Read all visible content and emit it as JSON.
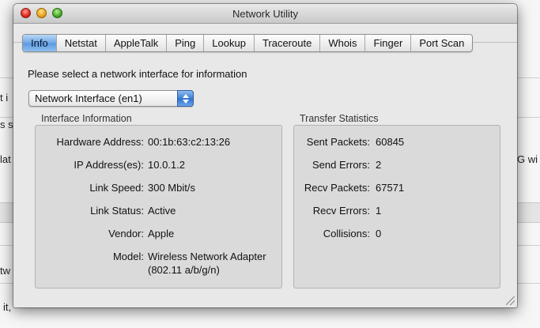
{
  "window": {
    "title": "Network Utility"
  },
  "tabs": [
    {
      "label": "Info",
      "active": true
    },
    {
      "label": "Netstat",
      "active": false
    },
    {
      "label": "AppleTalk",
      "active": false
    },
    {
      "label": "Ping",
      "active": false
    },
    {
      "label": "Lookup",
      "active": false
    },
    {
      "label": "Traceroute",
      "active": false
    },
    {
      "label": "Whois",
      "active": false
    },
    {
      "label": "Finger",
      "active": false
    },
    {
      "label": "Port Scan",
      "active": false
    }
  ],
  "prompt": "Please select a network interface for information",
  "interface_select": {
    "selected": "Network Interface (en1)"
  },
  "interface_info": {
    "title": "Interface Information",
    "hardware_address": {
      "label": "Hardware Address:",
      "value": "00:1b:63:c2:13:26"
    },
    "ip_addresses": {
      "label": "IP Address(es):",
      "value": "10.0.1.2"
    },
    "link_speed": {
      "label": "Link Speed:",
      "value": "300 Mbit/s"
    },
    "link_status": {
      "label": "Link Status:",
      "value": "Active"
    },
    "vendor": {
      "label": "Vendor:",
      "value": "Apple"
    },
    "model": {
      "label": "Model:",
      "value_line1": "Wireless Network Adapter",
      "value_line2": "(802.11 a/b/g/n)"
    }
  },
  "transfer_stats": {
    "title": "Transfer Statistics",
    "sent_packets": {
      "label": "Sent Packets:",
      "value": "60845"
    },
    "send_errors": {
      "label": "Send Errors:",
      "value": "2"
    },
    "recv_packets": {
      "label": "Recv Packets:",
      "value": "67571"
    },
    "recv_errors": {
      "label": "Recv Errors:",
      "value": "1"
    },
    "collisions": {
      "label": "Collisions:",
      "value": "0"
    }
  },
  "background_fragments": {
    "f1": "t i",
    "f2": "s s",
    "f3": "lat",
    "f4": "G wi",
    "f5": "tw",
    "f6": "it,"
  },
  "colors": {
    "active_tab": "#6fa7e6",
    "window_bg": "#e8e8e8",
    "group_bg": "#dadada"
  }
}
